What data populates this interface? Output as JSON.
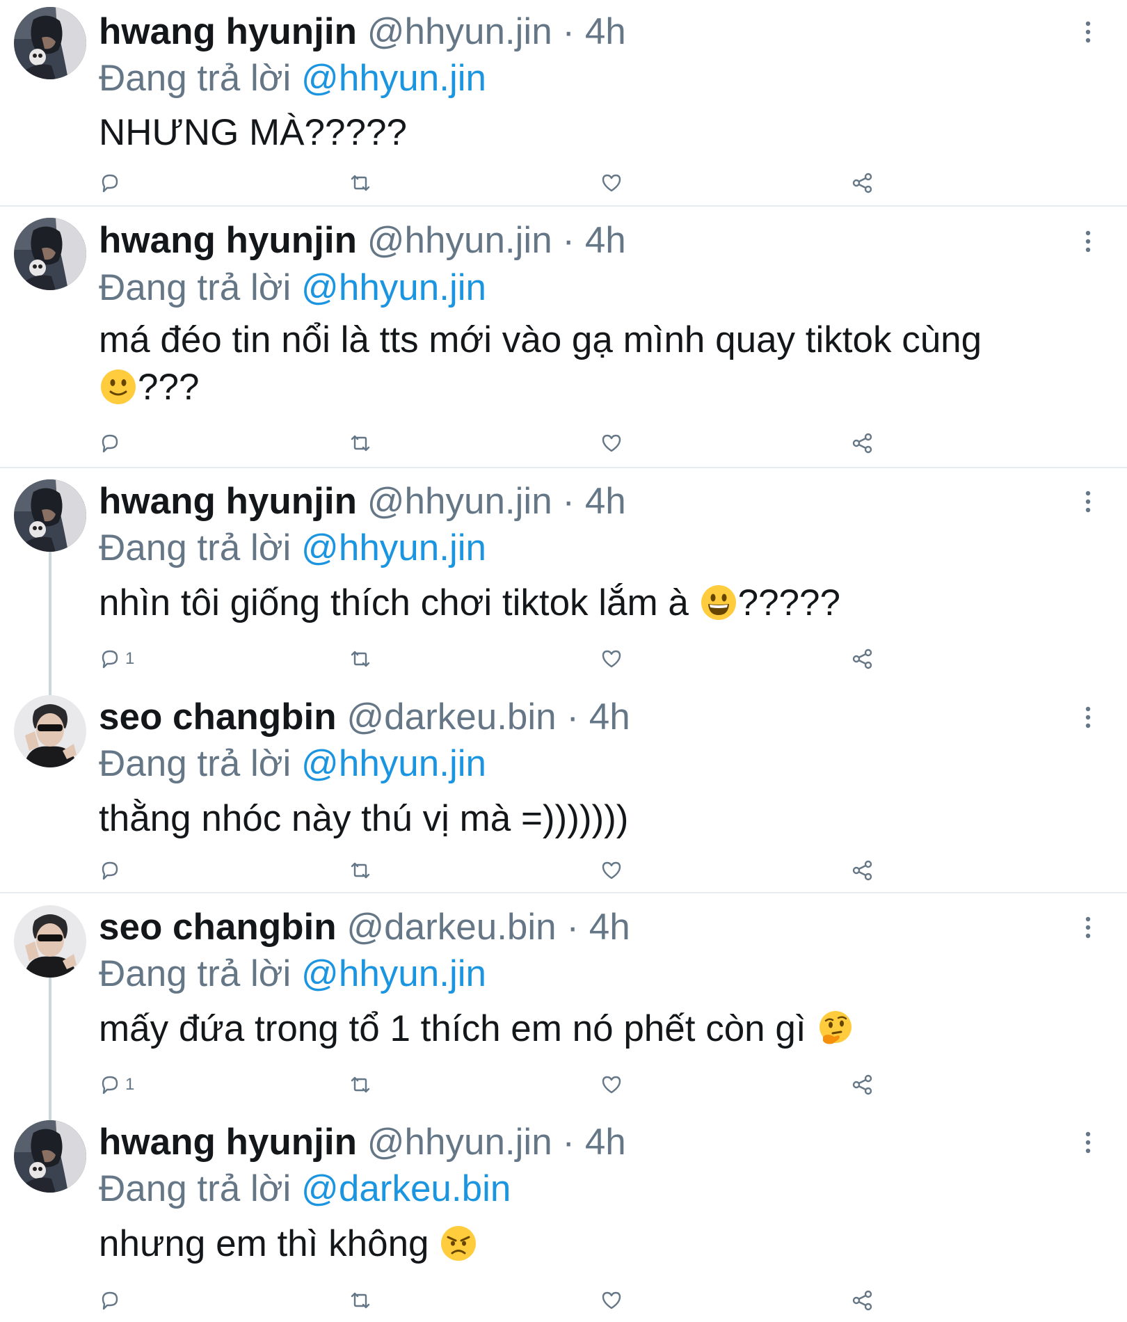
{
  "reply_prefix": "Đang trả lời",
  "colors": {
    "link": "#1b95e0",
    "secondary_text": "#657786",
    "primary_text": "#14171a",
    "divider": "#e6ecf0",
    "thread_line": "#ccd6dd"
  },
  "icons": {
    "reply": "speech-bubble",
    "retweet": "retweet-arrows",
    "like": "heart",
    "share": "share-nodes",
    "more": "vertical-ellipsis"
  },
  "tweets": [
    {
      "name": "hwang hyunjin",
      "handle": "@hhyun.jin",
      "separator": "·",
      "time": "4h",
      "reply_to": "@hhyun.jin",
      "text_parts": [
        "NHƯNG MÀ?????"
      ],
      "reply_count": ""
    },
    {
      "name": "hwang hyunjin",
      "handle": "@hhyun.jin",
      "separator": "·",
      "time": "4h",
      "reply_to": "@hhyun.jin",
      "text_parts": [
        "má đéo tin nổi là tts mới vào gạ mình quay tiktok cùng",
        "???"
      ],
      "emoji": "slightly-smiling-face",
      "reply_count": ""
    },
    {
      "name": "hwang hyunjin",
      "handle": "@hhyun.jin",
      "separator": "·",
      "time": "4h",
      "reply_to": "@hhyun.jin",
      "text_parts": [
        "nhìn tôi giống thích chơi tiktok lắm à ",
        "?????"
      ],
      "emoji": "grinning-face",
      "reply_count": "1"
    },
    {
      "name": "seo changbin",
      "handle": "@darkeu.bin",
      "separator": "·",
      "time": "4h",
      "reply_to": "@hhyun.jin",
      "text_parts": [
        "thằng nhóc này thú vị mà =)))))))"
      ],
      "reply_count": ""
    },
    {
      "name": "seo changbin",
      "handle": "@darkeu.bin",
      "separator": "·",
      "time": "4h",
      "reply_to": "@hhyun.jin",
      "text_parts": [
        "mấy đứa trong tổ 1 thích em nó phết còn gì ",
        ""
      ],
      "emoji": "thinking-face",
      "reply_count": "1"
    },
    {
      "name": "hwang hyunjin",
      "handle": "@hhyun.jin",
      "separator": "·",
      "time": "4h",
      "reply_to": "@darkeu.bin",
      "text_parts": [
        "nhưng em thì không ",
        ""
      ],
      "emoji": "angry-face",
      "reply_count": ""
    }
  ]
}
